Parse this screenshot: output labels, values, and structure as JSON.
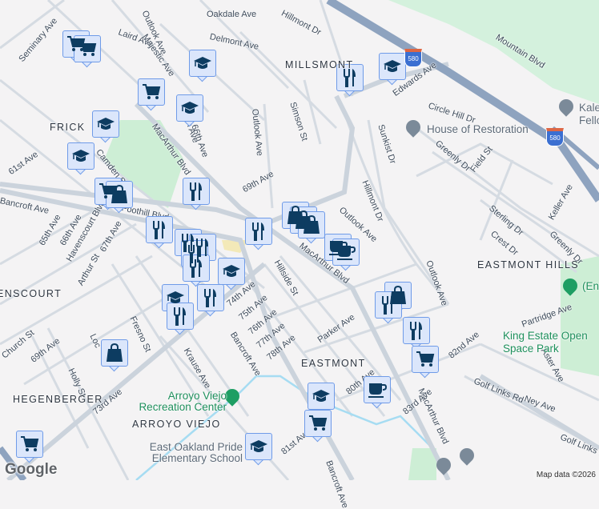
{
  "map": {
    "neighborhoods": [
      "MILLSMONT",
      "FRICK",
      "EASTMONT HILLS",
      "EASTMONT",
      "HEGENBERGER",
      "ARROYO VIEJO",
      "ENSCOURT"
    ],
    "pois": [
      {
        "name": "House of Restoration",
        "kind": "church"
      },
      {
        "name": "Kale Fello",
        "kind": "church"
      },
      {
        "name": "King Estate Open Space Park",
        "kind": "park"
      },
      {
        "name": "Arroyo Viejo Recreation Center",
        "kind": "park"
      },
      {
        "name": "East Oakland Pride Elementary School",
        "kind": "school"
      },
      {
        "name": "(En",
        "kind": "park"
      }
    ],
    "highway_shield": "580",
    "street_labels": [
      "Oakdale Ave",
      "Delmont Ave",
      "Hillmont Dr",
      "Outlook Ave",
      "Laird Ave",
      "Majestic Ave",
      "Seminary Ave",
      "Edwards Ave",
      "Mountain Blvd",
      "Circle Hill Dr",
      "Simson St",
      "Sunkist Dr",
      "Greenly Dr",
      "Field St",
      "Outlook Ave",
      "66th Ave",
      "65th Ave",
      "MacArthur Blvd",
      "Camden St",
      "61st Ave",
      "69th Ave",
      "Foothill Blvd",
      "Bancroft Ave",
      "65th Ave",
      "66th Ave",
      "67th Ave",
      "Havenscourt Blvd",
      "Arthur St",
      "Hillmont Dr",
      "Outlook Ave",
      "MacArthur Blvd",
      "Hillside St",
      "74th Ave",
      "75th Ave",
      "76th Ave",
      "77th Ave",
      "78th Ave",
      "Parker Ave",
      "Outlook Ave",
      "Sterling Dr",
      "Crest Dr",
      "Keller Ave",
      "Greenly Dr",
      "Partridge Ave",
      "82nd Ave",
      "Aster Ave",
      "Golf Links Rd",
      "Ney Ave",
      "Golf Links Rd",
      "Fresno St",
      "Krause Ave",
      "Bancroft Ave",
      "73rd Ave",
      "69th Ave",
      "Holly St",
      "Church St",
      "MacArthur Blvd",
      "80th Ave",
      "83rd Ave",
      "81st Ave",
      "Bancroft Ave",
      "Loc"
    ],
    "markers": [
      "shopping-cart",
      "shopping-cart",
      "education",
      "shopping-cart",
      "education",
      "education",
      "restaurant",
      "education",
      "education",
      "shopping-cart",
      "shopping-bag",
      "restaurant",
      "shopping-bag",
      "shopping-bag",
      "shopping-bag",
      "restaurant",
      "restaurant",
      "restaurant",
      "restaurant",
      "restaurant",
      "restaurant",
      "education",
      "cafe",
      "cafe",
      "education",
      "restaurant",
      "restaurant",
      "shopping-bag",
      "restaurant",
      "restaurant",
      "shopping-cart",
      "shopping-bag",
      "cafe",
      "education",
      "shopping-cart",
      "education",
      "shopping-cart"
    ],
    "attribution": "Map data ©2026",
    "logo": "Google",
    "colors": {
      "marker_bg": "#dbe6fb",
      "marker_border": "#6f9be8",
      "marker_icon": "#0d3c61",
      "park": "#c9efd6",
      "highway": "#8ea3bf",
      "water": "#9fd8f0"
    }
  }
}
